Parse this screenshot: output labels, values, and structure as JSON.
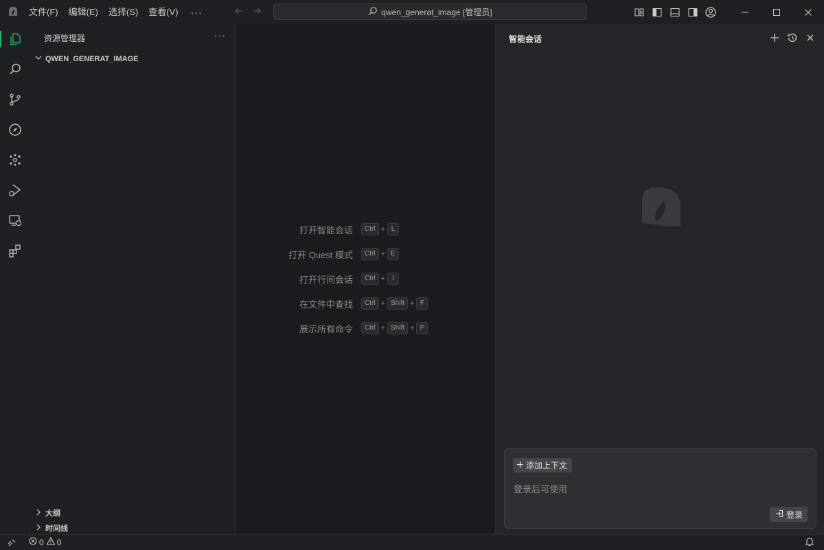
{
  "menu": {
    "file": "文件(F)",
    "edit": "编辑(E)",
    "select": "选择(S)",
    "view": "查看(V)",
    "more": "···"
  },
  "search": {
    "text": "qwen_generat_image [管理员]"
  },
  "sidebar": {
    "title": "资源管理器",
    "more": "···",
    "root_folder": "QWEN_GENERAT_IMAGE",
    "outline": "大纲",
    "timeline": "时间线"
  },
  "editor": {
    "shortcuts": [
      {
        "label": "打开智能会话",
        "keys": [
          "Ctrl",
          "L"
        ]
      },
      {
        "label": "打开 Quest 模式",
        "keys": [
          "Ctrl",
          "E"
        ]
      },
      {
        "label": "打开行间会话",
        "keys": [
          "Ctrl",
          "I"
        ]
      },
      {
        "label": "在文件中查找",
        "keys": [
          "Ctrl",
          "Shift",
          "F"
        ]
      },
      {
        "label": "展示所有命令",
        "keys": [
          "Ctrl",
          "Shift",
          "P"
        ]
      }
    ],
    "plus": "+"
  },
  "chat": {
    "title": "智能会话",
    "add_context": "添加上下文",
    "input_placeholder": "登录后可使用",
    "login": "登录"
  },
  "status": {
    "errors": "0",
    "warnings": "0"
  },
  "colors": {
    "accent": "#23b56b",
    "background": "#1f2023",
    "editor": "#1b1c1f",
    "chat": "#252629"
  }
}
